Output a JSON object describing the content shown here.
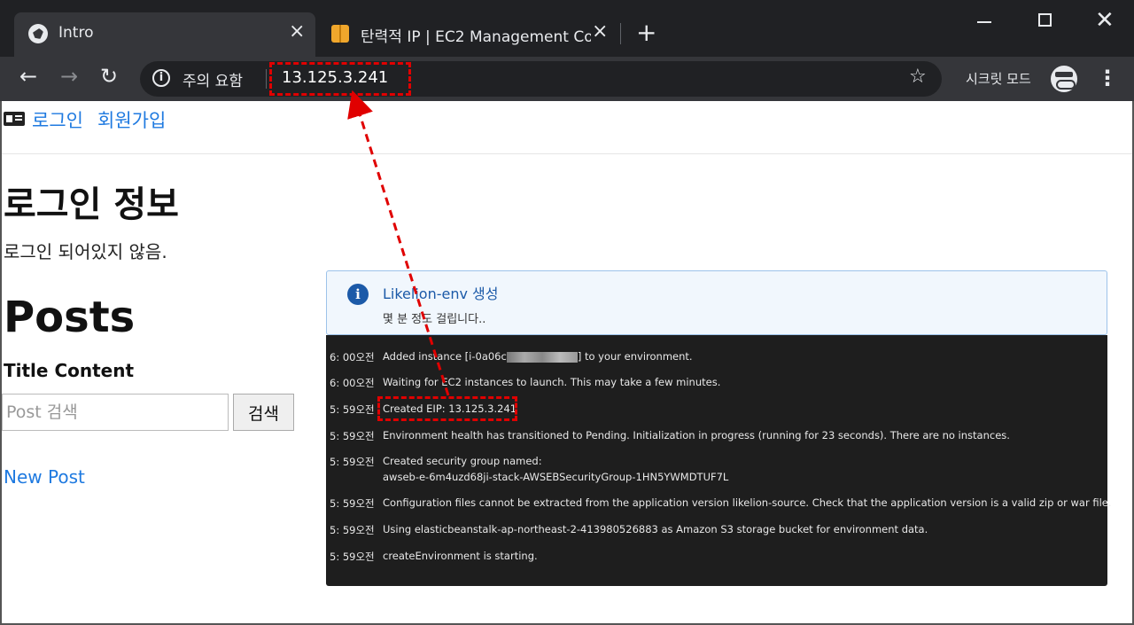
{
  "browser": {
    "tabs": [
      {
        "title": "Intro",
        "active": true
      },
      {
        "title": "탄력적 IP | EC2 Management Co",
        "active": false
      }
    ],
    "address": {
      "security_label": "주의 요함",
      "url": "13.125.3.241"
    },
    "profile_label": "시크릿 모드"
  },
  "page": {
    "nav": {
      "login": "로그인",
      "signup": "회원가입"
    },
    "login_heading": "로그인 정보",
    "login_status": "로그인 되어있지 않음.",
    "posts_heading": "Posts",
    "columns_heading": "Title Content",
    "search": {
      "placeholder": "Post 검색",
      "button": "검색"
    },
    "new_post": "New Post"
  },
  "eb_panel": {
    "title": "Likelion-env 생성",
    "subtitle": "몇 분 정도 걸립니다..",
    "events": [
      {
        "time": "6: 00오전",
        "message_prefix": "Added instance [i-0a06c",
        "message_suffix": "] to your environment.",
        "redacted": true
      },
      {
        "time": "6: 00오전",
        "message": "Waiting for EC2 instances to launch. This may take a few minutes."
      },
      {
        "time": "5: 59오전",
        "message": "Created EIP: 13.125.3.241"
      },
      {
        "time": "5: 59오전",
        "message": "Environment health has transitioned to Pending. Initialization in progress (running for 23 seconds). There are no instances."
      },
      {
        "time": "5: 59오전",
        "message": "Created security group named:",
        "message_line2": "awseb-e-6m4uzd68ji-stack-AWSEBSecurityGroup-1HN5YWMDTUF7L"
      },
      {
        "time": "5: 59오전",
        "message": "Configuration files cannot be extracted from the application version likelion-source. Check that the application version is a valid zip or war file."
      },
      {
        "time": "5: 59오전",
        "message": "Using elasticbeanstalk-ap-northeast-2-413980526883 as Amazon S3 storage bucket for environment data."
      },
      {
        "time": "5: 59오전",
        "message": "createEnvironment is starting."
      }
    ]
  },
  "colors": {
    "chrome_dark": "#202124",
    "chrome_toolbar": "#35363a",
    "link_blue": "#1f7ae0",
    "annotation_red": "#e00000",
    "info_blue": "#1c5aa8"
  }
}
